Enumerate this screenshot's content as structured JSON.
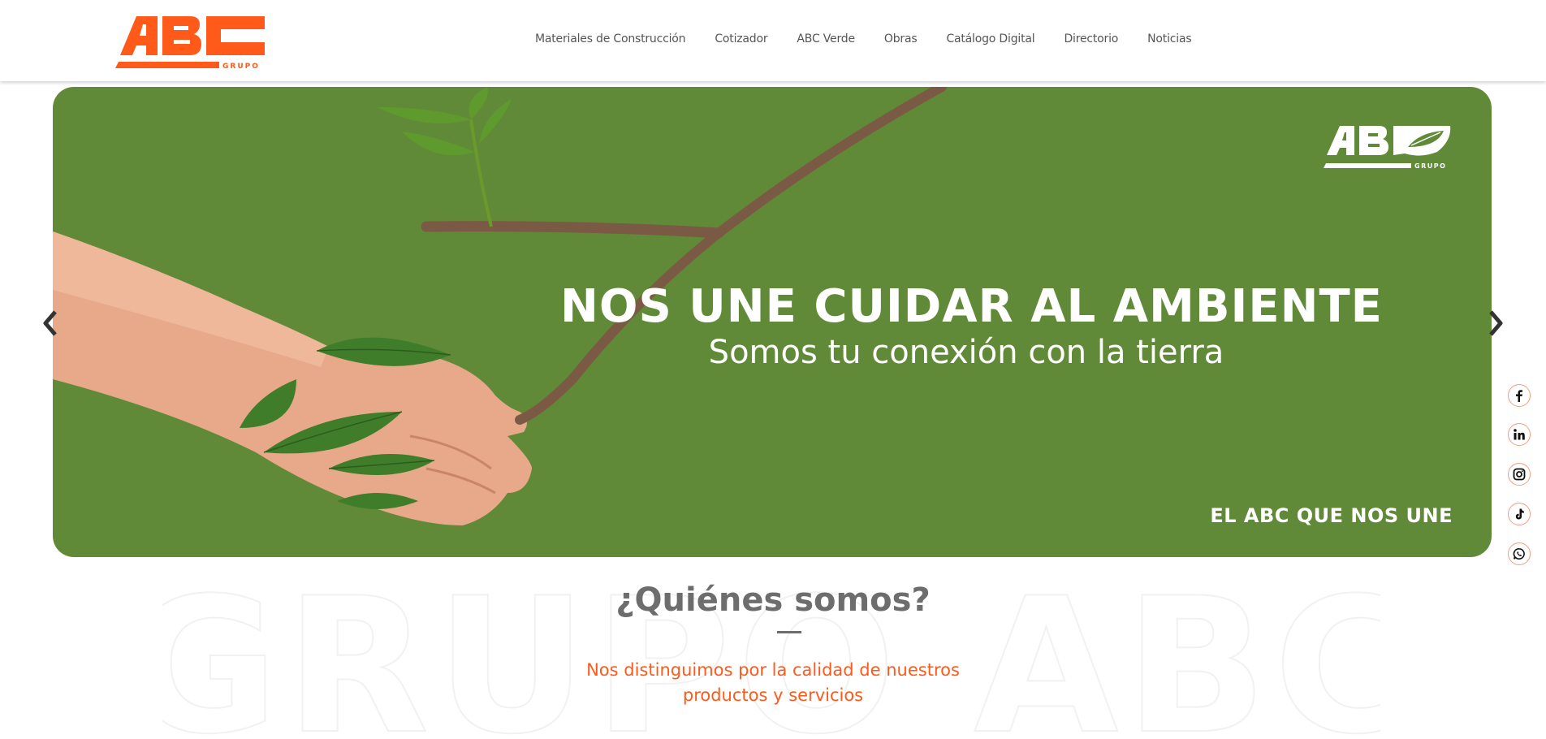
{
  "brand": {
    "logo_text": "ABC",
    "logo_subtext": "GRUPO",
    "accent": "#ff5a1a",
    "hero_green": "#618a38"
  },
  "nav": {
    "items": [
      {
        "label": "Materiales de Construcción"
      },
      {
        "label": "Cotizador"
      },
      {
        "label": "ABC Verde"
      },
      {
        "label": "Obras"
      },
      {
        "label": "Catálogo Digital"
      },
      {
        "label": "Directorio"
      },
      {
        "label": "Noticias"
      }
    ]
  },
  "hero": {
    "title": "NOS UNE CUIDAR AL AMBIENTE",
    "subtitle": "Somos tu conexión con la tierra",
    "tagline": "EL ABC QUE NOS UNE",
    "logo_text": "ABC",
    "logo_subtext": "GRUPO"
  },
  "social": {
    "icons": [
      "facebook-icon",
      "linkedin-icon",
      "instagram-icon",
      "tiktok-icon",
      "whatsapp-icon"
    ]
  },
  "about": {
    "watermark": "GRUPO ABC",
    "title": "¿Quiénes somos?",
    "text": "Nos distinguimos por la calidad de nuestros productos y servicios"
  }
}
